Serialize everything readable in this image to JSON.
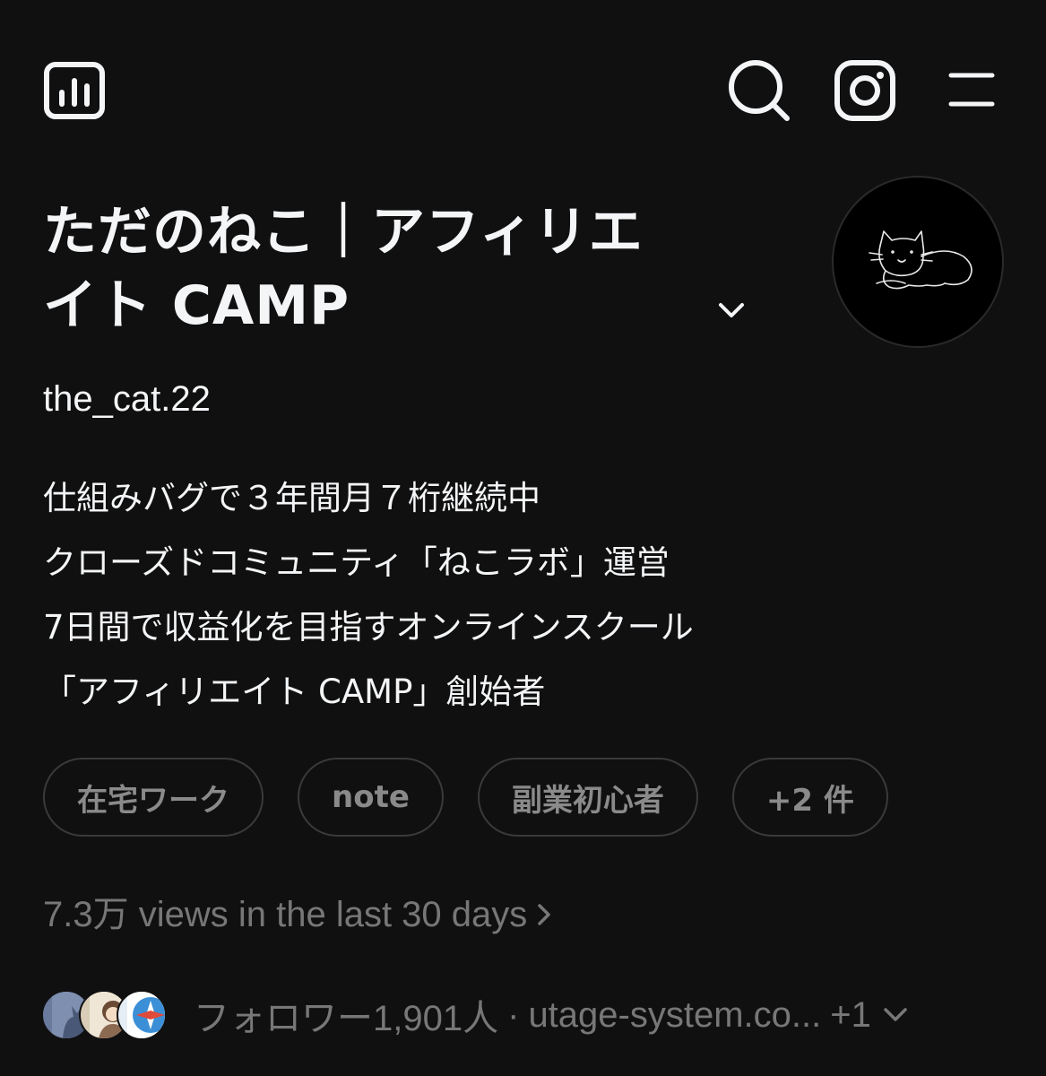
{
  "header": {
    "icons": [
      "insights-icon",
      "search-icon",
      "instagram-icon",
      "menu-icon"
    ]
  },
  "profile": {
    "name_line1": "ただのねこ｜アフィリエ",
    "name_line2": "イト CAMP",
    "handle": "the_cat.22",
    "bio": [
      "仕組みバグで３年間月７桁継続中",
      "クローズドコミュニティ「ねこラボ」運営",
      "7日間で収益化を目指すオンラインスクール",
      "「アフィリエイト CAMP」創始者"
    ],
    "tags": [
      "在宅ワーク",
      "note",
      "副業初心者",
      "+2 件"
    ],
    "views_text": "7.3万 views in the last 30 days",
    "followers_text": "フォロワー1,901人",
    "separator": "·",
    "link_text": "utage-system.co...",
    "more_links": "+1"
  },
  "colors": {
    "background": "#101010",
    "primary_text": "#f3f5f7",
    "secondary_text": "#777777",
    "tag_border": "#3a3a3a"
  }
}
